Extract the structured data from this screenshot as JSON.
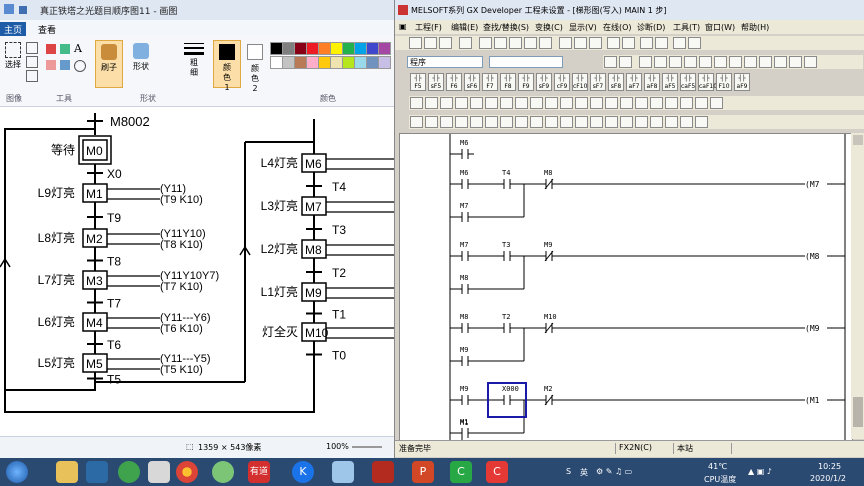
{
  "paint": {
    "title": "真正铁塔之光题目顺序图11 - 画图",
    "tabs": [
      "主页",
      "查看"
    ],
    "groups": [
      "图像",
      "工具",
      "形状",
      "颜色"
    ],
    "select_label": "选择",
    "brush_label": "刷子",
    "shapes_label": "形状",
    "thickness_label": "粗细",
    "color1_label": "颜色1",
    "color2_label": "颜色2",
    "dimensions": "1359 × 543像素",
    "zoom": "100%",
    "palette": [
      "#000000",
      "#7f7f7f",
      "#880015",
      "#ed1c24",
      "#ff7f27",
      "#fff200",
      "#22b14c",
      "#00a2e8",
      "#3f48cc",
      "#a349a4",
      "#ffffff",
      "#c3c3c3",
      "#b97a57",
      "#ffaec9",
      "#ffc90e",
      "#efe4b0",
      "#b5e61d",
      "#99d9ea",
      "#7092be",
      "#c8bfe7"
    ],
    "sfc": {
      "top_label": "M8002",
      "left": {
        "steps": [
          "M0",
          "M1",
          "M2",
          "M3",
          "M4",
          "M5"
        ],
        "step_names": [
          "等待",
          "L9灯亮",
          "L8灯亮",
          "L7灯亮",
          "L6灯亮",
          "L5灯亮"
        ],
        "transitions": [
          "X0",
          "T9",
          "T8",
          "T7",
          "T6",
          "T5"
        ],
        "actions": [
          {
            "out": "Y11",
            "timer": "T9 K10"
          },
          {
            "out": "Y11Y10",
            "timer": "T8 K10"
          },
          {
            "out": "Y11Y10Y7",
            "timer": "T7 K10"
          },
          {
            "out": "Y11---Y6",
            "timer": "T6 K10"
          },
          {
            "out": "Y11---Y5",
            "timer": "T5 K10"
          }
        ]
      },
      "right": {
        "steps": [
          "M6",
          "M7",
          "M8",
          "M9",
          "M10"
        ],
        "step_names": [
          "L4灯亮",
          "L3灯亮",
          "L2灯亮",
          "L1灯亮",
          "灯全灭"
        ],
        "transitions": [
          "T4",
          "T3",
          "T2",
          "T1",
          "T0"
        ]
      }
    }
  },
  "gx": {
    "title": "MELSOFT系列 GX Developer 工程未设置 - [梯形图(写入)    MAIN    1 步]",
    "menu": [
      "工程(F)",
      "编辑(E)",
      "查找/替换(S)",
      "变换(C)",
      "显示(V)",
      "在线(O)",
      "诊断(D)",
      "工具(T)",
      "窗口(W)",
      "帮助(H)"
    ],
    "combo_program": "程序",
    "fkeys_row1": [
      "F5",
      "sF5",
      "F6",
      "sF6",
      "F7",
      "F8",
      "F9",
      "sF9",
      "cF9",
      "cF10",
      "sF7",
      "sF8",
      "aF7",
      "aF8",
      "aF5",
      "caF5",
      "caF10",
      "F10",
      "aF9"
    ],
    "ladder": {
      "rungs": [
        {
          "contacts": [
            "M6"
          ],
          "coil": ""
        },
        {
          "contacts": [
            "M6",
            "T4",
            "M8"
          ],
          "coil": "M7",
          "parallel": "M7"
        },
        {
          "contacts": [
            "M7",
            "T3",
            "M9"
          ],
          "coil": "M8",
          "parallel": "M8"
        },
        {
          "contacts": [
            "M8",
            "T2",
            "M10"
          ],
          "coil": "M9",
          "parallel": "M9"
        },
        {
          "contacts": [
            "M9",
            "X000",
            "M2"
          ],
          "coil": "M1",
          "parallel": "M1"
        }
      ]
    },
    "status": {
      "ready": "准备完毕",
      "plc": "FX2N(C)",
      "station": "本站"
    }
  },
  "taskbar": {
    "apps": [
      "有道"
    ],
    "ime": "英",
    "temp": "41℃",
    "cpu": "CPU温度",
    "time": "10:25",
    "date": "2020/1/2"
  },
  "colors": {
    "accent": "#1f5ca8",
    "taskbar": "#2b4a72",
    "ladder_line": "#000000"
  }
}
